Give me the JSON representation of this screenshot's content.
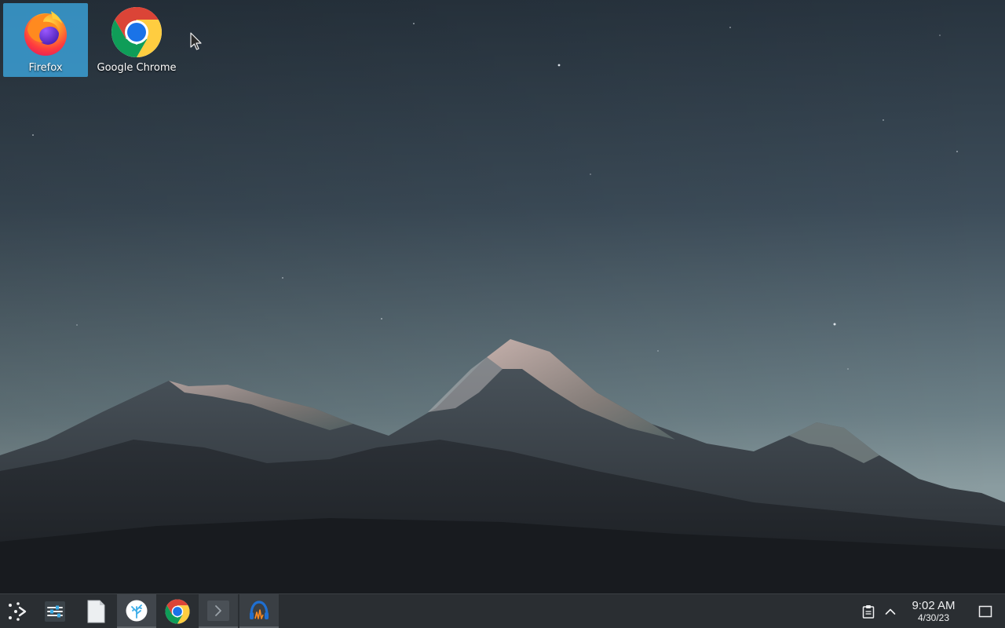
{
  "desktop": {
    "icons": [
      {
        "label": "Firefox",
        "icon": "firefox-icon",
        "selected": true
      },
      {
        "label": "Google Chrome",
        "icon": "chrome-icon",
        "selected": false
      }
    ]
  },
  "taskbar": {
    "launcher_icon": "application-launcher-icon",
    "tasks": [
      {
        "name": "system-settings",
        "icon": "settings-sliders-icon"
      },
      {
        "name": "text-editor",
        "icon": "document-icon"
      },
      {
        "name": "discover",
        "icon": "discover-icon"
      },
      {
        "name": "google-chrome",
        "icon": "chrome-icon"
      },
      {
        "name": "terminal",
        "icon": "terminal-icon"
      },
      {
        "name": "audio-app",
        "icon": "headphones-icon"
      }
    ],
    "tray": {
      "clipboard_icon": "clipboard-icon",
      "expand_icon": "chevron-up-icon"
    },
    "clock": {
      "time": "9:02 AM",
      "date": "4/30/23"
    },
    "show_desktop_icon": "show-desktop-icon"
  },
  "colors": {
    "selection": "#3daee9",
    "taskbar_bg": "#2a2e32"
  }
}
